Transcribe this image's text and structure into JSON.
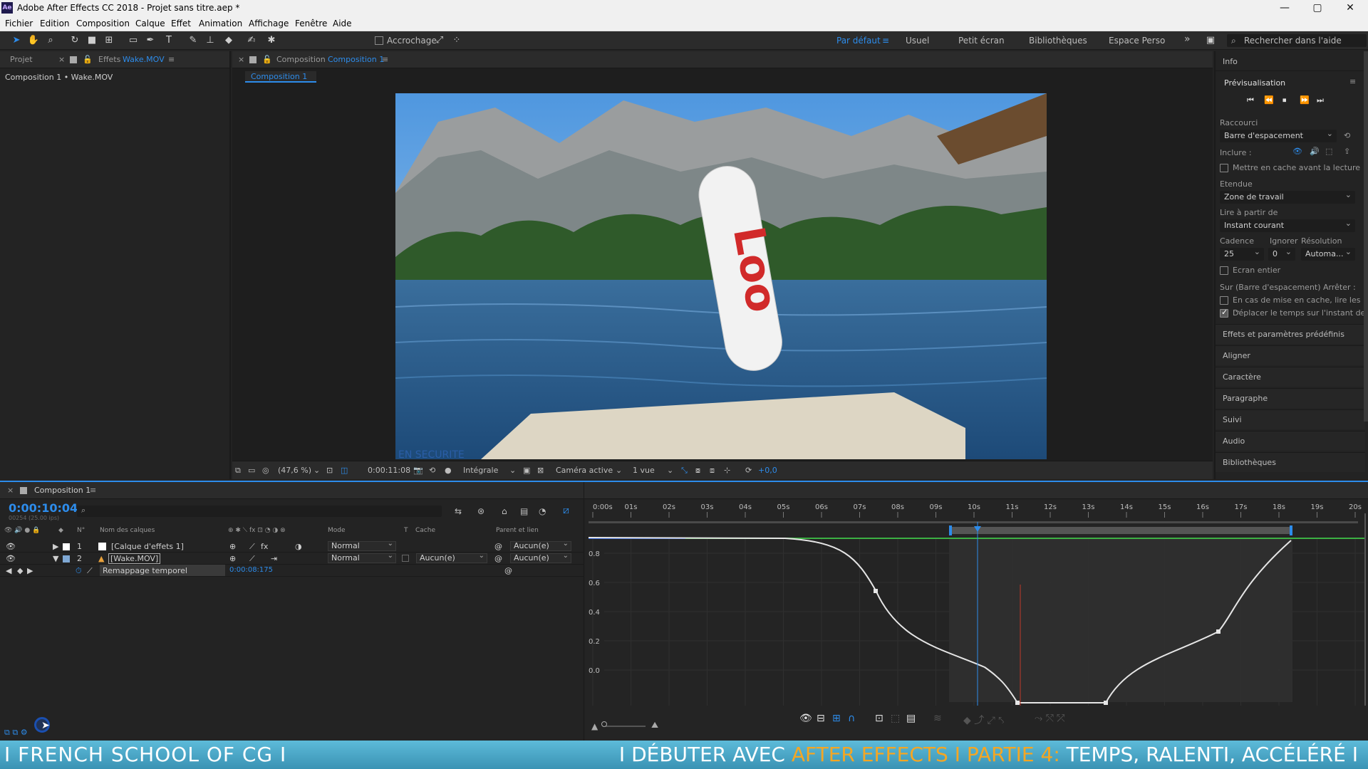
{
  "app": {
    "title": "Adobe After Effects CC 2018 - Projet sans titre.aep *",
    "logo": "Ae",
    "window_controls": [
      "—",
      "▢",
      "✕"
    ]
  },
  "menu": [
    "Fichier",
    "Edition",
    "Composition",
    "Calque",
    "Effet",
    "Animation",
    "Affichage",
    "Fenêtre",
    "Aide"
  ],
  "toolbar": {
    "snap_label": "Accrochage",
    "workspaces": [
      "Par défaut",
      "Usuel",
      "Petit écran",
      "Bibliothèques",
      "Espace Perso"
    ],
    "active_workspace": "Par défaut",
    "search_placeholder": "Rechercher dans l'aide",
    "more": "»"
  },
  "project_panel": {
    "tab_project": "Projet",
    "tab_effects": "Effets",
    "tab_effects_target": "Wake.MOV",
    "breadcrumb": "Composition 1 • Wake.MOV"
  },
  "comp_viewer": {
    "tab_label": "Composition",
    "tab_target": "Composition 1",
    "subtab": "Composition 1",
    "image_text": "EN SECURITE",
    "footer": {
      "zoom": "(47,6 %)",
      "timecode": "0:00:11:08",
      "resolution": "Intégrale",
      "camera": "Caméra active",
      "views": "1 vue",
      "exposure": "+0,0"
    }
  },
  "right_panel": {
    "info": "Info",
    "preview_title": "Prévisualisation",
    "shortcut_label": "Raccourci",
    "shortcut_value": "Barre d'espacement",
    "include_label": "Inclure :",
    "cache_before": "Mettre en cache avant la lecture",
    "range_label": "Etendue",
    "range_value": "Zone de travail",
    "play_from_label": "Lire à partir de",
    "play_from_value": "Instant courant",
    "cadence_label": "Cadence",
    "ignore_label": "Ignorer",
    "resolution_label": "Résolution",
    "cadence_value": "25",
    "ignore_value": "0",
    "resolution_value": "Automa...",
    "fullscreen": "Ecran entier",
    "stop_label": "Sur (Barre d'espacement) Arrêter :",
    "opt_cache": "En cas de mise en cache, lire les ...",
    "opt_move_time": "Déplacer le temps sur l'instant de pr",
    "sections": [
      "Effets et paramètres prédéfinis",
      "Aligner",
      "Caractère",
      "Paragraphe",
      "Suivi",
      "Audio",
      "Bibliothèques"
    ]
  },
  "timeline": {
    "tab": "Composition 1",
    "timecode": "0:00:10:04",
    "timecode_sub": "00254 (25.00 ips)",
    "columns": {
      "num": "N°",
      "name": "Nom des calques",
      "mode": "Mode",
      "t": "T",
      "cache": "Cache",
      "parent": "Parent et lien"
    },
    "layers": [
      {
        "num": "1",
        "name": "[Calque d'effets 1]",
        "mode": "Normal",
        "cache": "",
        "parent": "Aucun(e)",
        "color": "#ffffff"
      },
      {
        "num": "2",
        "name": "[Wake.MOV]",
        "mode": "Normal",
        "cache": "Aucun(e)",
        "parent": "Aucun(e)",
        "color": "#7fa8d4"
      }
    ],
    "property": {
      "name": "Remappage temporel",
      "value": "0:00:08:175"
    },
    "ruler": [
      "0:00s",
      "01s",
      "02s",
      "03s",
      "04s",
      "05s",
      "06s",
      "07s",
      "08s",
      "09s",
      "10s",
      "11s",
      "12s",
      "13s",
      "14s",
      "15s",
      "16s",
      "17s",
      "18s",
      "19s",
      "20s"
    ],
    "graph_y_labels": [
      "0.8",
      "0.6",
      "0.4",
      "0.2",
      "0.0"
    ]
  },
  "banner": {
    "left": "I FRENCH SCHOOL OF CG I",
    "right_prefix": "I DÉBUTER AVEC ",
    "right_highlight": "AFTER EFFECTS",
    "right_mid": " I PARTIE 4",
    "right_colon": ":",
    "right_suffix": " TEMPS, RALENTI, ACCÉLÉRÉ I"
  }
}
